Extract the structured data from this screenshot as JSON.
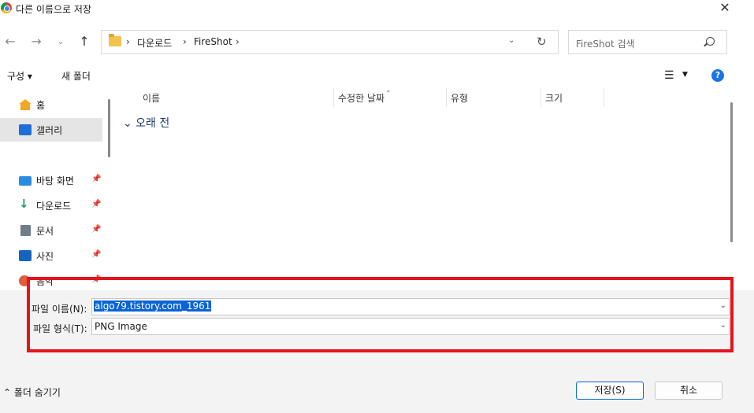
{
  "window": {
    "title": "다른 이름으로 저장",
    "close_glyph": "✕"
  },
  "nav": {
    "back_glyph": "←",
    "forward_glyph": "→",
    "recent_glyph": "⌄",
    "up_glyph": "↑",
    "breadcrumb": [
      "다운로드",
      "FireShot"
    ],
    "crumb_separator": "›",
    "dropdown_glyph": "⌄",
    "refresh_glyph": "↻"
  },
  "search": {
    "placeholder": "FireShot 검색"
  },
  "toolbar": {
    "organize_label": "구성 ▾",
    "new_folder_label": "새 폴더",
    "view_glyph": "☰",
    "view_dropdown_glyph": "▼",
    "help_glyph": "?"
  },
  "sidebar": {
    "items": [
      {
        "label": "홈",
        "icon": "home-icon",
        "pinned": false,
        "selected": false
      },
      {
        "label": "갤러리",
        "icon": "gallery-icon",
        "pinned": false,
        "selected": true
      },
      {
        "label": "바탕 화면",
        "icon": "desktop-icon",
        "pinned": true,
        "selected": false
      },
      {
        "label": "다운로드",
        "icon": "download-icon",
        "pinned": true,
        "selected": false
      },
      {
        "label": "문서",
        "icon": "documents-icon",
        "pinned": true,
        "selected": false
      },
      {
        "label": "사진",
        "icon": "pictures-icon",
        "pinned": true,
        "selected": false
      },
      {
        "label": "음악",
        "icon": "music-icon",
        "pinned": true,
        "selected": false
      }
    ],
    "pin_glyph": "📌",
    "download_glyph": "↓"
  },
  "filelist": {
    "columns": [
      "이름",
      "수정한 날짜",
      "유형",
      "크기"
    ],
    "sort_glyph": "⌄",
    "group_label": "⌄ 오래 전"
  },
  "form": {
    "filename_label": "파일 이름(N):",
    "filename_value": "algo79.tistory.com_1961",
    "filetype_label": "파일 형식(T):",
    "filetype_value": "PNG Image",
    "dropdown_glyph": "⌄"
  },
  "footer": {
    "toggle_folders_label": "⌃ 폴더 숨기기",
    "save_label": "저장(S)",
    "cancel_label": "취소"
  },
  "colors": {
    "highlight": "#e3141e",
    "accent": "#0a64d6"
  }
}
